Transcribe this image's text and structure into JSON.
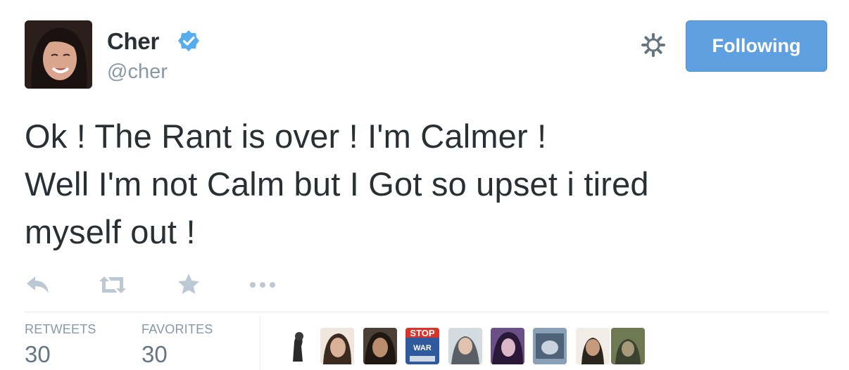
{
  "user": {
    "name": "Cher",
    "handle": "@cher",
    "avatar_icon": "profile-photo"
  },
  "header": {
    "settings_icon": "gear-icon",
    "follow_label": "Following",
    "verified_icon": "verified-badge-icon"
  },
  "tweet": {
    "lines": [
      "Ok ! The Rant is over ! I'm Calmer !",
      "Well I'm not Calm but I Got so upset i tired",
      "myself out !"
    ]
  },
  "actions": {
    "reply_icon": "reply-icon",
    "retweet_icon": "retweet-icon",
    "favorite_icon": "star-icon",
    "more_icon": "more-dots-icon"
  },
  "stats": {
    "retweets_label": "RETWEETS",
    "retweets_value": "30",
    "favorites_label": "FAVORITES",
    "favorites_value": "30"
  },
  "favoriters": {
    "count_shown": 10,
    "stop_war_badge": {
      "top": "STOP",
      "bottom": "WAR"
    }
  },
  "colors": {
    "button_bg": "#5fa0e0",
    "verified": "#55acee",
    "muted": "#8899a6",
    "text": "#292f33"
  }
}
